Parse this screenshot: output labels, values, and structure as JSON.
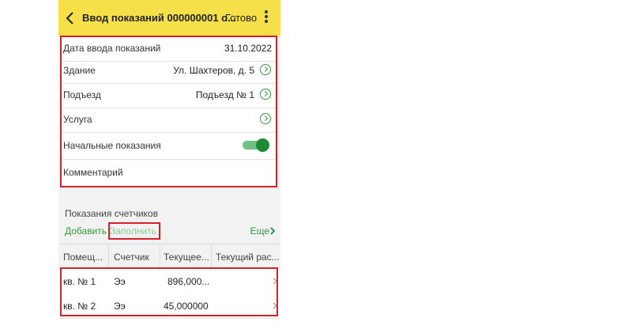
{
  "header": {
    "title": "Ввод показаний 000000001 о...",
    "done_label": "Готово"
  },
  "form": {
    "date": {
      "label": "Дата ввода показаний",
      "value": "31.10.2022"
    },
    "building": {
      "label": "Здание",
      "value": "Ул. Шахтеров, д. 5"
    },
    "entrance": {
      "label": "Подъезд",
      "value": "Подъезд  № 1"
    },
    "service": {
      "label": "Услуга",
      "value": ""
    },
    "initial_readings": {
      "label": "Начальные показания",
      "on": true
    },
    "comment": {
      "label": "Комментарий",
      "value": ""
    }
  },
  "counters": {
    "section_title": "Показания счетчиков",
    "add_label": "Добавить",
    "fill_label": "Заполнить",
    "more_label": "Еще",
    "columns": [
      "Помещ...",
      "Счетчик",
      "Текущее...",
      "Текущий рас..."
    ],
    "rows": [
      {
        "room": "кв. № 1",
        "meter": "Ээ",
        "current": "896,000...",
        "consumption": ""
      },
      {
        "room": "кв. № 2",
        "meter": "Ээ",
        "current": "45,000000",
        "consumption": ""
      }
    ]
  },
  "colors": {
    "header_bg": "#f5e04a",
    "accent_green": "#2e9e3a",
    "highlight_red": "#d6202b"
  }
}
